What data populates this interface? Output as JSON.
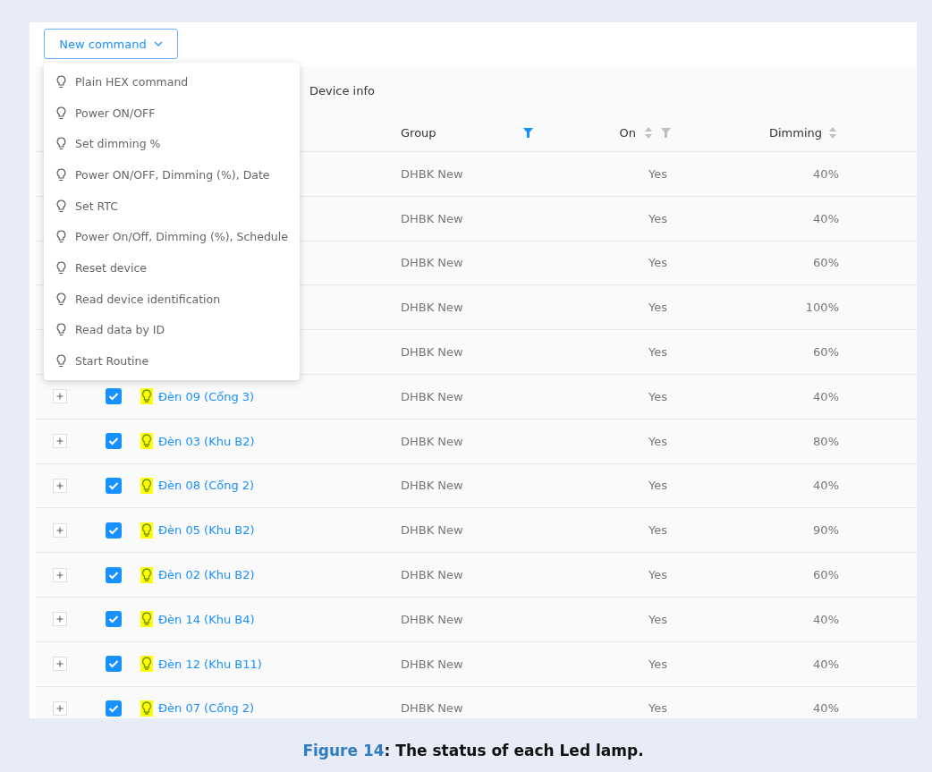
{
  "new_command_button": {
    "label": "New command"
  },
  "menu": {
    "items": [
      {
        "label": "Plain HEX command"
      },
      {
        "label": "Power ON/OFF"
      },
      {
        "label": "Set dimming %"
      },
      {
        "label": "Power ON/OFF, Dimming (%), Date"
      },
      {
        "label": "Set RTC"
      },
      {
        "label": "Power On/Off, Dimming (%), Schedule"
      },
      {
        "label": "Reset device"
      },
      {
        "label": "Read device identification"
      },
      {
        "label": "Read data by ID"
      },
      {
        "label": "Start Routine"
      }
    ]
  },
  "table": {
    "group_header": "Device info",
    "columns": [
      {
        "label": "Group",
        "sortable": false,
        "filterable": true,
        "filtered": true
      },
      {
        "label": "On",
        "sortable": true,
        "filterable": true,
        "filtered": false
      },
      {
        "label": "Dimming",
        "sortable": true,
        "filterable": false
      }
    ],
    "rows": [
      {
        "group": "DHBK New",
        "on": "Yes",
        "dimming": "40%"
      },
      {
        "group": "DHBK New",
        "on": "Yes",
        "dimming": "40%"
      },
      {
        "group": "DHBK New",
        "on": "Yes",
        "dimming": "60%"
      },
      {
        "group": "DHBK New",
        "on": "Yes",
        "dimming": "100%"
      },
      {
        "group": "DHBK New",
        "on": "Yes",
        "dimming": "60%"
      },
      {
        "name": "Đèn 09 (Cổng 3)",
        "checked": true,
        "group": "DHBK New",
        "on": "Yes",
        "dimming": "40%"
      },
      {
        "name": "Đèn 03 (Khu B2)",
        "checked": true,
        "group": "DHBK New",
        "on": "Yes",
        "dimming": "80%"
      },
      {
        "name": "Đèn 08 (Cổng 2)",
        "checked": true,
        "group": "DHBK New",
        "on": "Yes",
        "dimming": "40%"
      },
      {
        "name": "Đèn 05 (Khu B2)",
        "checked": true,
        "group": "DHBK New",
        "on": "Yes",
        "dimming": "90%"
      },
      {
        "name": "Đèn 02 (Khu B2)",
        "checked": true,
        "group": "DHBK New",
        "on": "Yes",
        "dimming": "60%"
      },
      {
        "name": "Đèn 14 (Khu B4)",
        "checked": true,
        "group": "DHBK New",
        "on": "Yes",
        "dimming": "40%"
      },
      {
        "name": "Đèn 12 (Khu B11)",
        "checked": true,
        "group": "DHBK New",
        "on": "Yes",
        "dimming": "40%"
      },
      {
        "name": "Đèn 07 (Cổng 2)",
        "checked": true,
        "group": "DHBK New",
        "on": "Yes",
        "dimming": "40%"
      }
    ]
  },
  "caption": {
    "label": "Figure 14",
    "text": ": The status of each Led lamp."
  }
}
